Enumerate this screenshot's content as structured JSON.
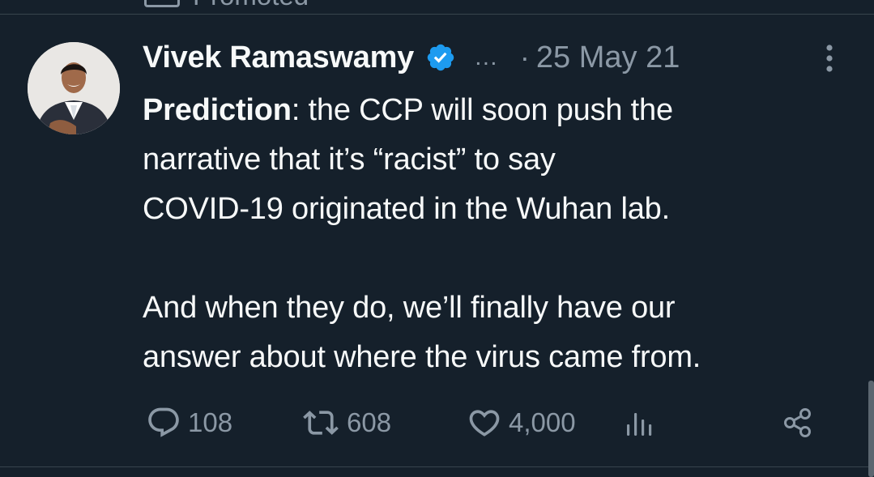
{
  "promoted": {
    "label": "Promoted"
  },
  "tweet": {
    "author": {
      "name": "Vivek Ramaswamy",
      "handle_truncated": "…",
      "verified": true,
      "avatar_icon": "avatar-photo"
    },
    "separator": "·",
    "timestamp": "25 May 21",
    "text": {
      "lead_bold": "Prediction",
      "line1_rest": ": the CCP will soon push the",
      "line2": "narrative that it’s “racist” to say",
      "line3": "COVID-19 originated in the Wuhan lab.",
      "line4": "And when they do, we’ll finally have our",
      "line5": "answer about where the virus came from."
    },
    "stats": {
      "replies": "108",
      "retweets": "608",
      "likes": "4,000"
    }
  },
  "icons": {
    "verified": "verified-badge-icon",
    "more": "more-vertical-icon",
    "reply": "reply-icon",
    "retweet": "retweet-icon",
    "like": "heart-icon",
    "views": "views-icon",
    "share": "share-icon"
  },
  "colors": {
    "background": "#15202b",
    "text_primary": "#f7f9f9",
    "text_secondary": "#8b98a5",
    "divider": "#38444d",
    "verified_blue": "#1d9bf0"
  }
}
